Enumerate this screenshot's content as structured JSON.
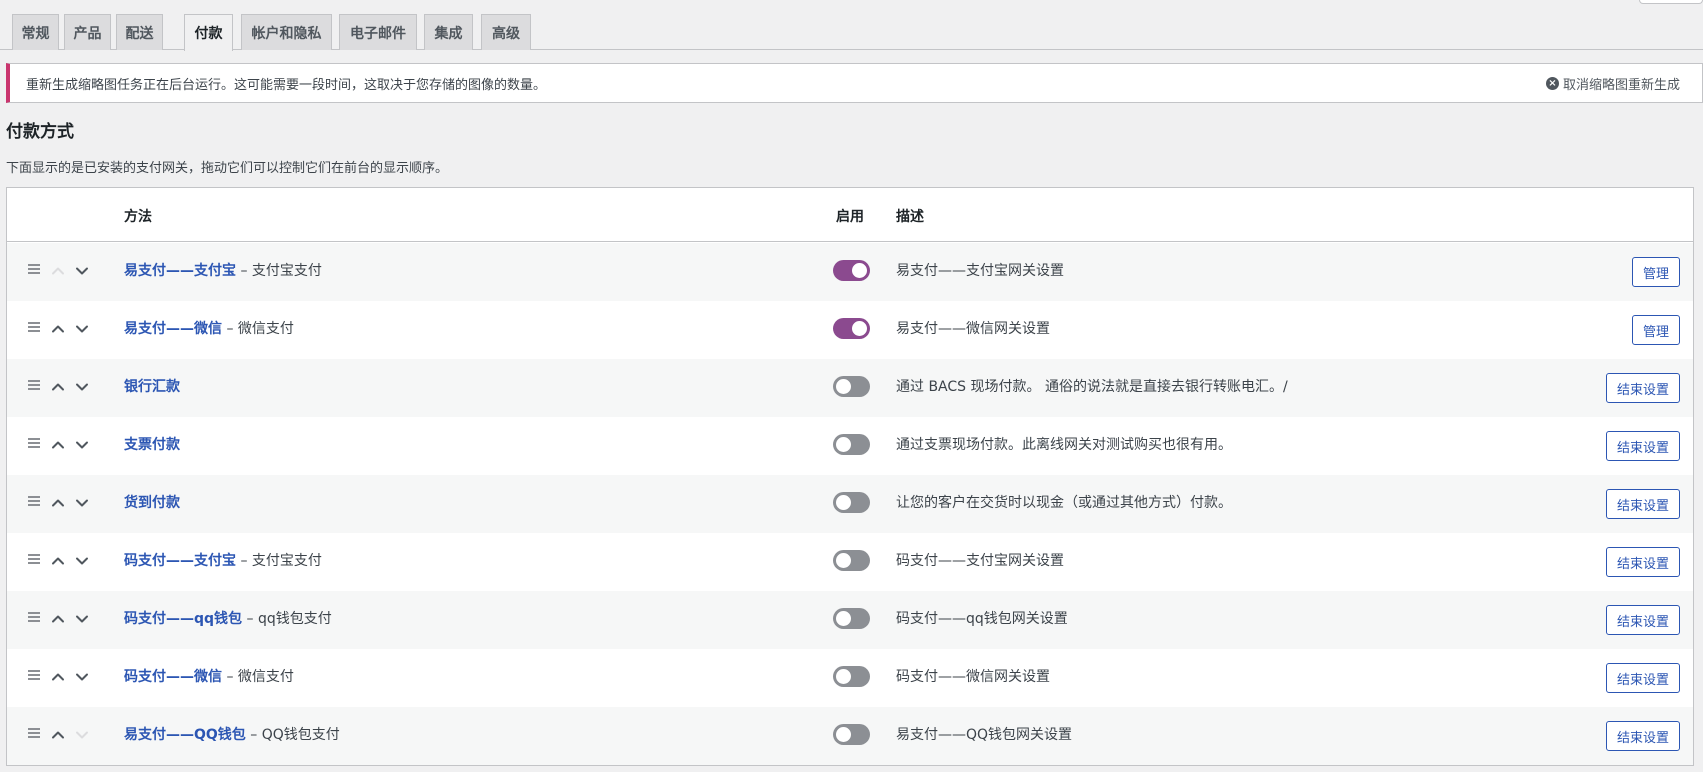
{
  "tabs": [
    {
      "label": "常规"
    },
    {
      "label": "产品"
    },
    {
      "label": "配送"
    },
    {
      "label": "付款"
    },
    {
      "label": "帐户和隐私"
    },
    {
      "label": "电子邮件"
    },
    {
      "label": "集成"
    },
    {
      "label": "高级"
    }
  ],
  "active_tab": "付款",
  "notice": {
    "text": "重新生成缩略图任务正在后台运行。这可能需要一段时间，这取决于您存储的图像的数量。",
    "dismiss_label": "取消缩略图重新生成"
  },
  "section": {
    "title": "付款方式",
    "description": "下面显示的是已安装的支付网关，拖动它们可以控制它们在前台的显示顺序。"
  },
  "table": {
    "headers": {
      "method": "方法",
      "enabled": "启用",
      "description": "描述"
    },
    "rows": [
      {
        "name": "易支付——支付宝",
        "sub": " – 支付宝支付",
        "enabled": true,
        "description": "易支付——支付宝网关设置",
        "action": "管理",
        "up_disabled": true,
        "down_disabled": false
      },
      {
        "name": "易支付——微信",
        "sub": " – 微信支付",
        "enabled": true,
        "description": "易支付——微信网关设置",
        "action": "管理",
        "up_disabled": false,
        "down_disabled": false
      },
      {
        "name": "银行汇款",
        "sub": "",
        "enabled": false,
        "description": "通过 BACS 现场付款。 通俗的说法就是直接去银行转账电汇。/",
        "action": "结束设置",
        "up_disabled": false,
        "down_disabled": false
      },
      {
        "name": "支票付款",
        "sub": "",
        "enabled": false,
        "description": "通过支票现场付款。此离线网关对测试购买也很有用。",
        "action": "结束设置",
        "up_disabled": false,
        "down_disabled": false
      },
      {
        "name": "货到付款",
        "sub": "",
        "enabled": false,
        "description": "让您的客户在交货时以现金（或通过其他方式）付款。",
        "action": "结束设置",
        "up_disabled": false,
        "down_disabled": false
      },
      {
        "name": "码支付——支付宝",
        "sub": " – 支付宝支付",
        "enabled": false,
        "description": "码支付——支付宝网关设置",
        "action": "结束设置",
        "up_disabled": false,
        "down_disabled": false
      },
      {
        "name": "码支付——qq钱包",
        "sub": " – qq钱包支付",
        "enabled": false,
        "description": "码支付——qq钱包网关设置",
        "action": "结束设置",
        "up_disabled": false,
        "down_disabled": false
      },
      {
        "name": "码支付——微信",
        "sub": " – 微信支付",
        "enabled": false,
        "description": "码支付——微信网关设置",
        "action": "结束设置",
        "up_disabled": false,
        "down_disabled": false
      },
      {
        "name": "易支付——QQ钱包",
        "sub": " – QQ钱包支付",
        "enabled": false,
        "description": "易支付——QQ钱包网关设置",
        "action": "结束设置",
        "up_disabled": false,
        "down_disabled": true
      }
    ]
  },
  "colors": {
    "toggle_on": "#8b4a8f",
    "toggle_off": "#8c8f94",
    "link": "#2c56b3",
    "notice_border": "#c9356e"
  }
}
